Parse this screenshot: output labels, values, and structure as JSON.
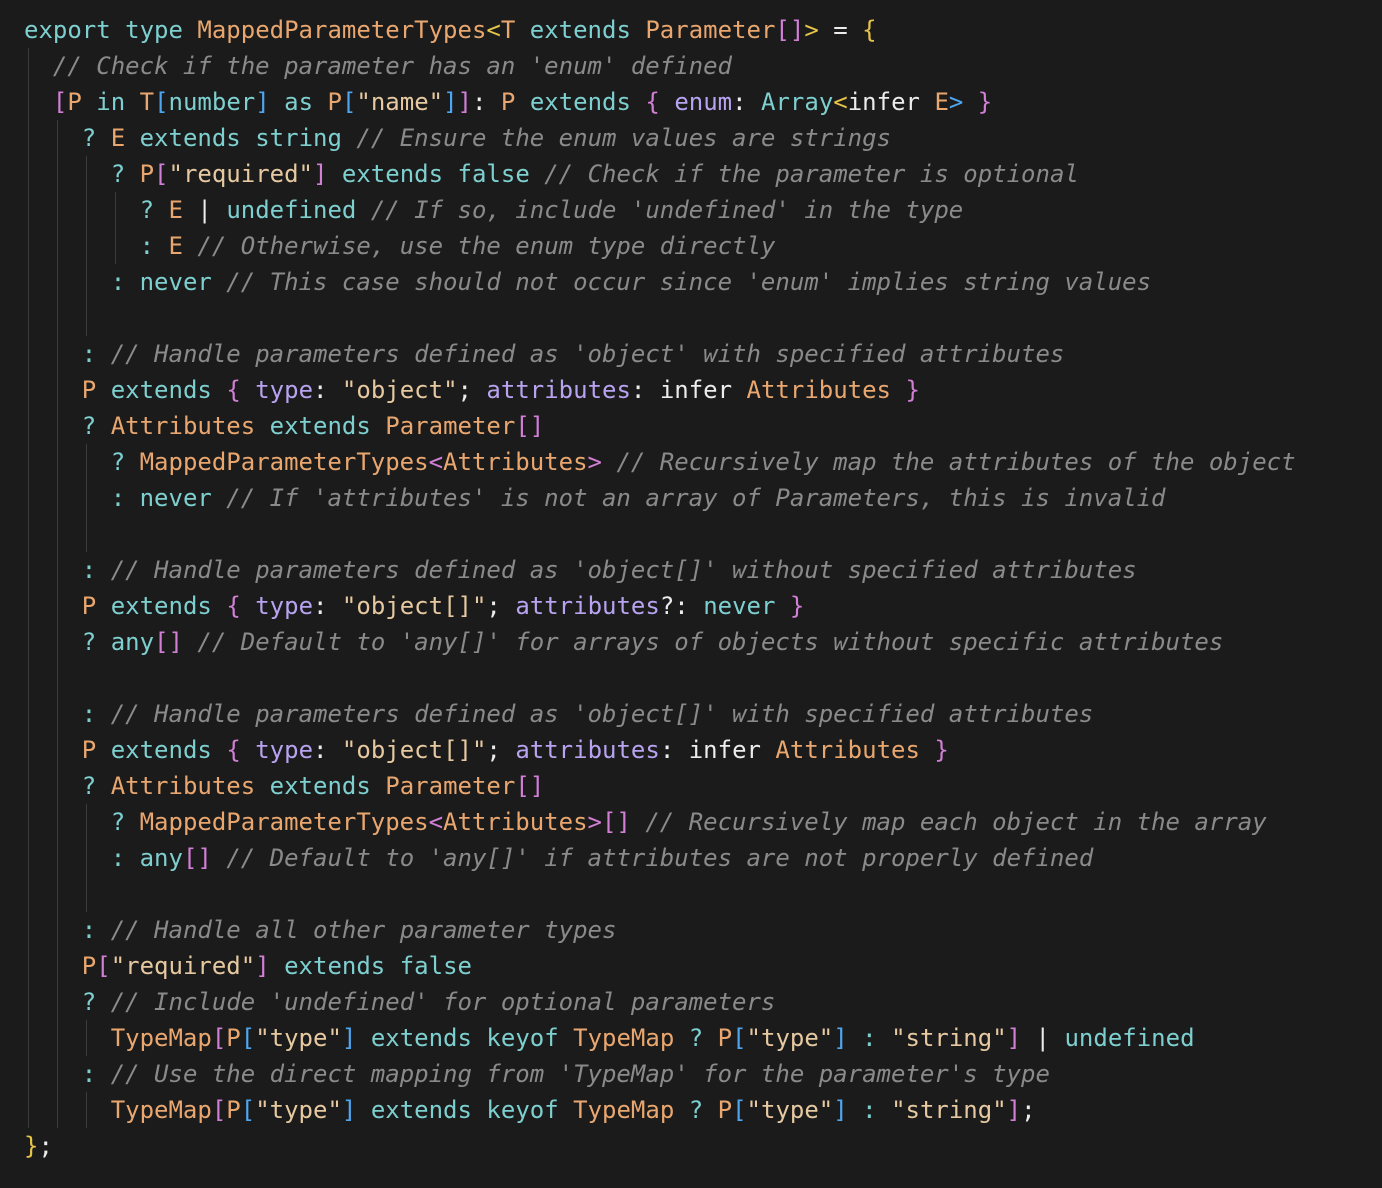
{
  "editor": {
    "language": "typescript",
    "colors": {
      "background": "#1b1b1b",
      "keyword": "#7ecfcf",
      "type": "#e9a76f",
      "string": "#e6c9a0",
      "comment": "#8a8a8a",
      "bracket_level1": "#e6c44a",
      "bracket_level2": "#d27fd6",
      "bracket_level3": "#4fa6f0",
      "property": "#b8a3f0"
    },
    "lines": [
      {
        "indent": 0,
        "tokens": [
          [
            "kw",
            "export"
          ],
          [
            "plain",
            " "
          ],
          [
            "kw",
            "type"
          ],
          [
            "plain",
            " "
          ],
          [
            "type",
            "MappedParameterTypes"
          ],
          [
            "bracket-y",
            "<"
          ],
          [
            "type",
            "T"
          ],
          [
            "plain",
            " "
          ],
          [
            "kw",
            "extends"
          ],
          [
            "plain",
            " "
          ],
          [
            "type",
            "Parameter"
          ],
          [
            "bracket-p",
            "[]"
          ],
          [
            "bracket-y",
            ">"
          ],
          [
            "plain",
            " = "
          ],
          [
            "bracket-y",
            "{"
          ]
        ]
      },
      {
        "indent": 1,
        "tokens": [
          [
            "cmt",
            "// Check if the parameter has an 'enum' defined"
          ]
        ]
      },
      {
        "indent": 1,
        "tokens": [
          [
            "bracket-p",
            "["
          ],
          [
            "type",
            "P"
          ],
          [
            "plain",
            " "
          ],
          [
            "kw",
            "in"
          ],
          [
            "plain",
            " "
          ],
          [
            "type",
            "T"
          ],
          [
            "bracket-b",
            "["
          ],
          [
            "kw",
            "number"
          ],
          [
            "bracket-b",
            "]"
          ],
          [
            "plain",
            " "
          ],
          [
            "kw",
            "as"
          ],
          [
            "plain",
            " "
          ],
          [
            "type",
            "P"
          ],
          [
            "bracket-b",
            "["
          ],
          [
            "str",
            "\"name\""
          ],
          [
            "bracket-b",
            "]"
          ],
          [
            "bracket-p",
            "]"
          ],
          [
            "plain",
            ": "
          ],
          [
            "type",
            "P"
          ],
          [
            "plain",
            " "
          ],
          [
            "kw",
            "extends"
          ],
          [
            "plain",
            " "
          ],
          [
            "bracket-p",
            "{"
          ],
          [
            "plain",
            " "
          ],
          [
            "prop",
            "enum"
          ],
          [
            "plain",
            ": "
          ],
          [
            "kw",
            "Array"
          ],
          [
            "bracket-y",
            "<"
          ],
          [
            "plain",
            "infer "
          ],
          [
            "type",
            "E"
          ],
          [
            "bracket-b",
            ">"
          ],
          [
            "plain",
            " "
          ],
          [
            "bracket-p",
            "}"
          ]
        ]
      },
      {
        "indent": 2,
        "tokens": [
          [
            "tern",
            "? "
          ],
          [
            "type",
            "E"
          ],
          [
            "plain",
            " "
          ],
          [
            "kw",
            "extends"
          ],
          [
            "plain",
            " "
          ],
          [
            "kw",
            "string"
          ],
          [
            "plain",
            " "
          ],
          [
            "cmt",
            "// Ensure the enum values are strings"
          ]
        ]
      },
      {
        "indent": 3,
        "tokens": [
          [
            "tern",
            "? "
          ],
          [
            "type",
            "P"
          ],
          [
            "bracket-p",
            "["
          ],
          [
            "str",
            "\"required\""
          ],
          [
            "bracket-p",
            "]"
          ],
          [
            "plain",
            " "
          ],
          [
            "kw",
            "extends"
          ],
          [
            "plain",
            " "
          ],
          [
            "kw",
            "false"
          ],
          [
            "plain",
            " "
          ],
          [
            "cmt",
            "// Check if the parameter is optional"
          ]
        ]
      },
      {
        "indent": 4,
        "tokens": [
          [
            "tern",
            "? "
          ],
          [
            "type",
            "E"
          ],
          [
            "plain",
            " | "
          ],
          [
            "kw",
            "undefined"
          ],
          [
            "plain",
            " "
          ],
          [
            "cmt",
            "// If so, include 'undefined' in the type"
          ]
        ]
      },
      {
        "indent": 4,
        "tokens": [
          [
            "tern",
            ": "
          ],
          [
            "type",
            "E"
          ],
          [
            "plain",
            " "
          ],
          [
            "cmt",
            "// Otherwise, use the enum type directly"
          ]
        ]
      },
      {
        "indent": 3,
        "tokens": [
          [
            "tern",
            ": "
          ],
          [
            "kw",
            "never"
          ],
          [
            "plain",
            " "
          ],
          [
            "cmt",
            "// This case should not occur since 'enum' implies string values"
          ]
        ]
      },
      {
        "indent": 3,
        "tokens": []
      },
      {
        "indent": 2,
        "tokens": [
          [
            "tern",
            ": "
          ],
          [
            "cmt",
            "// Handle parameters defined as 'object' with specified attributes"
          ]
        ]
      },
      {
        "indent": 2,
        "tokens": [
          [
            "type",
            "P"
          ],
          [
            "plain",
            " "
          ],
          [
            "kw",
            "extends"
          ],
          [
            "plain",
            " "
          ],
          [
            "bracket-p",
            "{"
          ],
          [
            "plain",
            " "
          ],
          [
            "prop",
            "type"
          ],
          [
            "plain",
            ": "
          ],
          [
            "str",
            "\"object\""
          ],
          [
            "plain",
            "; "
          ],
          [
            "prop",
            "attributes"
          ],
          [
            "plain",
            ": infer "
          ],
          [
            "type",
            "Attributes"
          ],
          [
            "plain",
            " "
          ],
          [
            "bracket-p",
            "}"
          ]
        ]
      },
      {
        "indent": 2,
        "tokens": [
          [
            "tern",
            "? "
          ],
          [
            "type",
            "Attributes"
          ],
          [
            "plain",
            " "
          ],
          [
            "kw",
            "extends"
          ],
          [
            "plain",
            " "
          ],
          [
            "type",
            "Parameter"
          ],
          [
            "bracket-p",
            "[]"
          ]
        ]
      },
      {
        "indent": 3,
        "tokens": [
          [
            "tern",
            "? "
          ],
          [
            "type",
            "MappedParameterTypes"
          ],
          [
            "bracket-p",
            "<"
          ],
          [
            "type",
            "Attributes"
          ],
          [
            "bracket-p",
            ">"
          ],
          [
            "plain",
            " "
          ],
          [
            "cmt",
            "// Recursively map the attributes of the object"
          ]
        ]
      },
      {
        "indent": 3,
        "tokens": [
          [
            "tern",
            ": "
          ],
          [
            "kw",
            "never"
          ],
          [
            "plain",
            " "
          ],
          [
            "cmt",
            "// If 'attributes' is not an array of Parameters, this is invalid"
          ]
        ]
      },
      {
        "indent": 3,
        "tokens": []
      },
      {
        "indent": 2,
        "tokens": [
          [
            "tern",
            ": "
          ],
          [
            "cmt",
            "// Handle parameters defined as 'object[]' without specified attributes"
          ]
        ]
      },
      {
        "indent": 2,
        "tokens": [
          [
            "type",
            "P"
          ],
          [
            "plain",
            " "
          ],
          [
            "kw",
            "extends"
          ],
          [
            "plain",
            " "
          ],
          [
            "bracket-p",
            "{"
          ],
          [
            "plain",
            " "
          ],
          [
            "prop",
            "type"
          ],
          [
            "plain",
            ": "
          ],
          [
            "str",
            "\"object[]\""
          ],
          [
            "plain",
            "; "
          ],
          [
            "prop",
            "attributes"
          ],
          [
            "plain",
            "?: "
          ],
          [
            "kw",
            "never"
          ],
          [
            "plain",
            " "
          ],
          [
            "bracket-p",
            "}"
          ]
        ]
      },
      {
        "indent": 2,
        "tokens": [
          [
            "tern",
            "? "
          ],
          [
            "kw",
            "any"
          ],
          [
            "bracket-p",
            "[]"
          ],
          [
            "plain",
            " "
          ],
          [
            "cmt",
            "// Default to 'any[]' for arrays of objects without specific attributes"
          ]
        ]
      },
      {
        "indent": 2,
        "tokens": []
      },
      {
        "indent": 2,
        "tokens": [
          [
            "tern",
            ": "
          ],
          [
            "cmt",
            "// Handle parameters defined as 'object[]' with specified attributes"
          ]
        ]
      },
      {
        "indent": 2,
        "tokens": [
          [
            "type",
            "P"
          ],
          [
            "plain",
            " "
          ],
          [
            "kw",
            "extends"
          ],
          [
            "plain",
            " "
          ],
          [
            "bracket-p",
            "{"
          ],
          [
            "plain",
            " "
          ],
          [
            "prop",
            "type"
          ],
          [
            "plain",
            ": "
          ],
          [
            "str",
            "\"object[]\""
          ],
          [
            "plain",
            "; "
          ],
          [
            "prop",
            "attributes"
          ],
          [
            "plain",
            ": infer "
          ],
          [
            "type",
            "Attributes"
          ],
          [
            "plain",
            " "
          ],
          [
            "bracket-p",
            "}"
          ]
        ]
      },
      {
        "indent": 2,
        "tokens": [
          [
            "tern",
            "? "
          ],
          [
            "type",
            "Attributes"
          ],
          [
            "plain",
            " "
          ],
          [
            "kw",
            "extends"
          ],
          [
            "plain",
            " "
          ],
          [
            "type",
            "Parameter"
          ],
          [
            "bracket-p",
            "[]"
          ]
        ]
      },
      {
        "indent": 3,
        "tokens": [
          [
            "tern",
            "? "
          ],
          [
            "type",
            "MappedParameterTypes"
          ],
          [
            "bracket-p",
            "<"
          ],
          [
            "type",
            "Attributes"
          ],
          [
            "bracket-p",
            ">[]"
          ],
          [
            "plain",
            " "
          ],
          [
            "cmt",
            "// Recursively map each object in the array"
          ]
        ]
      },
      {
        "indent": 3,
        "tokens": [
          [
            "tern",
            ": "
          ],
          [
            "kw",
            "any"
          ],
          [
            "bracket-p",
            "[]"
          ],
          [
            "plain",
            " "
          ],
          [
            "cmt",
            "// Default to 'any[]' if attributes are not properly defined"
          ]
        ]
      },
      {
        "indent": 3,
        "tokens": []
      },
      {
        "indent": 2,
        "tokens": [
          [
            "tern",
            ": "
          ],
          [
            "cmt",
            "// Handle all other parameter types"
          ]
        ]
      },
      {
        "indent": 2,
        "tokens": [
          [
            "type",
            "P"
          ],
          [
            "bracket-p",
            "["
          ],
          [
            "str",
            "\"required\""
          ],
          [
            "bracket-p",
            "]"
          ],
          [
            "plain",
            " "
          ],
          [
            "kw",
            "extends"
          ],
          [
            "plain",
            " "
          ],
          [
            "kw",
            "false"
          ]
        ]
      },
      {
        "indent": 2,
        "tokens": [
          [
            "tern",
            "? "
          ],
          [
            "cmt",
            "// Include 'undefined' for optional parameters"
          ]
        ]
      },
      {
        "indent": 3,
        "tokens": [
          [
            "type",
            "TypeMap"
          ],
          [
            "bracket-p",
            "["
          ],
          [
            "type",
            "P"
          ],
          [
            "bracket-b",
            "["
          ],
          [
            "str",
            "\"type\""
          ],
          [
            "bracket-b",
            "]"
          ],
          [
            "plain",
            " "
          ],
          [
            "kw",
            "extends"
          ],
          [
            "plain",
            " "
          ],
          [
            "kw",
            "keyof"
          ],
          [
            "plain",
            " "
          ],
          [
            "type",
            "TypeMap"
          ],
          [
            "plain",
            " "
          ],
          [
            "tern",
            "?"
          ],
          [
            "plain",
            " "
          ],
          [
            "type",
            "P"
          ],
          [
            "bracket-b",
            "["
          ],
          [
            "str",
            "\"type\""
          ],
          [
            "bracket-b",
            "]"
          ],
          [
            "plain",
            " "
          ],
          [
            "tern",
            ":"
          ],
          [
            "plain",
            " "
          ],
          [
            "str",
            "\"string\""
          ],
          [
            "bracket-p",
            "]"
          ],
          [
            "plain",
            " | "
          ],
          [
            "kw",
            "undefined"
          ]
        ]
      },
      {
        "indent": 2,
        "tokens": [
          [
            "tern",
            ": "
          ],
          [
            "cmt",
            "// Use the direct mapping from 'TypeMap' for the parameter's type"
          ]
        ]
      },
      {
        "indent": 3,
        "tokens": [
          [
            "type",
            "TypeMap"
          ],
          [
            "bracket-p",
            "["
          ],
          [
            "type",
            "P"
          ],
          [
            "bracket-b",
            "["
          ],
          [
            "str",
            "\"type\""
          ],
          [
            "bracket-b",
            "]"
          ],
          [
            "plain",
            " "
          ],
          [
            "kw",
            "extends"
          ],
          [
            "plain",
            " "
          ],
          [
            "kw",
            "keyof"
          ],
          [
            "plain",
            " "
          ],
          [
            "type",
            "TypeMap"
          ],
          [
            "plain",
            " "
          ],
          [
            "tern",
            "?"
          ],
          [
            "plain",
            " "
          ],
          [
            "type",
            "P"
          ],
          [
            "bracket-b",
            "["
          ],
          [
            "str",
            "\"type\""
          ],
          [
            "bracket-b",
            "]"
          ],
          [
            "plain",
            " "
          ],
          [
            "tern",
            ":"
          ],
          [
            "plain",
            " "
          ],
          [
            "str",
            "\"string\""
          ],
          [
            "bracket-p",
            "]"
          ],
          [
            "plain",
            ";"
          ]
        ]
      },
      {
        "indent": 0,
        "tokens": [
          [
            "bracket-y",
            "}"
          ],
          [
            "plain",
            ";"
          ]
        ]
      }
    ]
  }
}
